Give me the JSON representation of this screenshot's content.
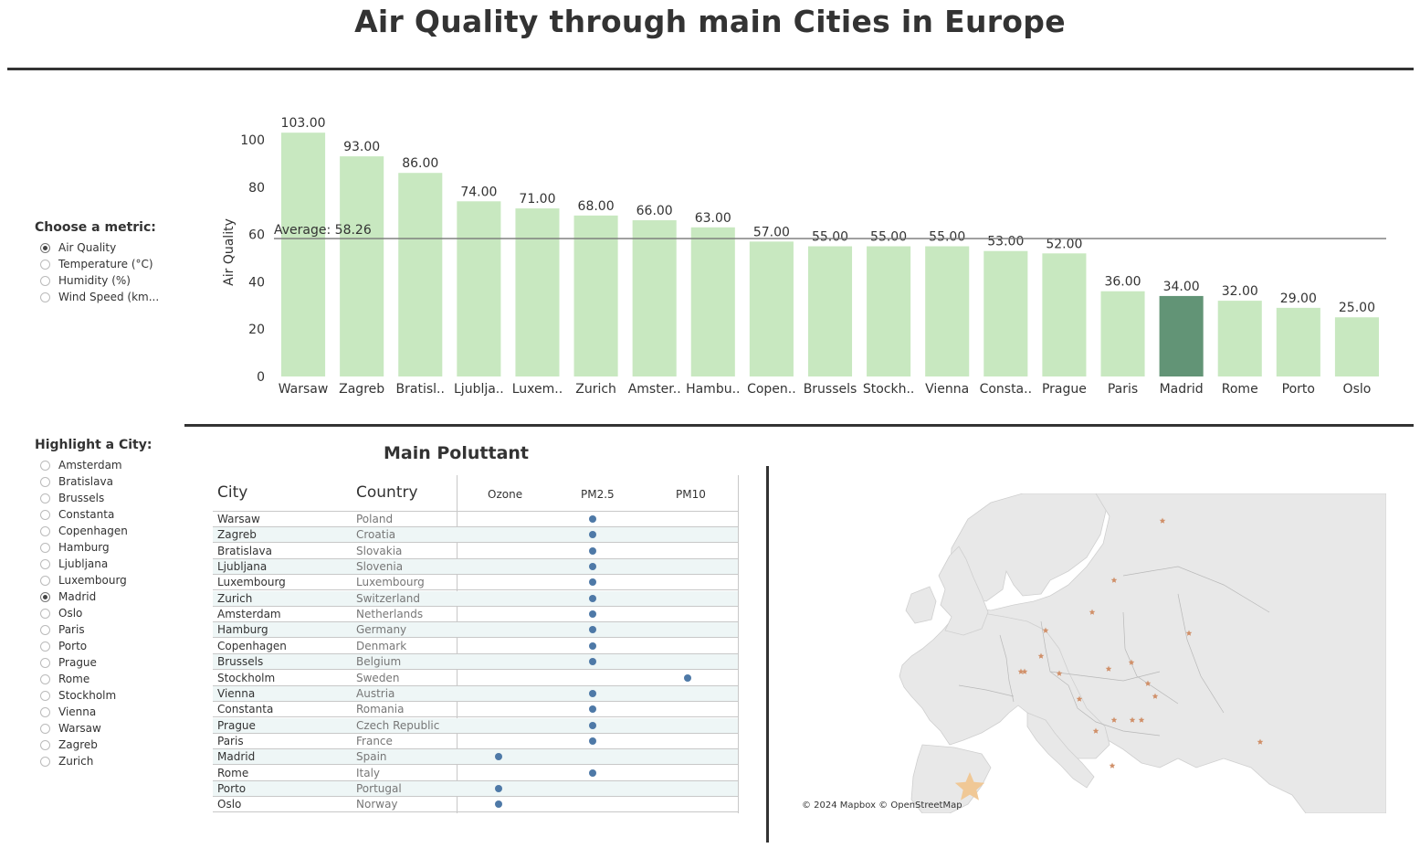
{
  "title": "Air Quality through main Cities in Europe",
  "metric_selector": {
    "heading": "Choose a metric:",
    "options": [
      {
        "label": "Air Quality",
        "selected": true
      },
      {
        "label": "Temperature (°C)",
        "selected": false
      },
      {
        "label": "Humidity (%)",
        "selected": false
      },
      {
        "label": "Wind Speed (km...",
        "selected": false
      }
    ]
  },
  "city_selector": {
    "heading": "Highlight a City:",
    "options": [
      {
        "label": "Amsterdam",
        "selected": false
      },
      {
        "label": "Bratislava",
        "selected": false
      },
      {
        "label": "Brussels",
        "selected": false
      },
      {
        "label": "Constanta",
        "selected": false
      },
      {
        "label": "Copenhagen",
        "selected": false
      },
      {
        "label": "Hamburg",
        "selected": false
      },
      {
        "label": "Ljubljana",
        "selected": false
      },
      {
        "label": "Luxembourg",
        "selected": false
      },
      {
        "label": "Madrid",
        "selected": true
      },
      {
        "label": "Oslo",
        "selected": false
      },
      {
        "label": "Paris",
        "selected": false
      },
      {
        "label": "Porto",
        "selected": false
      },
      {
        "label": "Prague",
        "selected": false
      },
      {
        "label": "Rome",
        "selected": false
      },
      {
        "label": "Stockholm",
        "selected": false
      },
      {
        "label": "Vienna",
        "selected": false
      },
      {
        "label": "Warsaw",
        "selected": false
      },
      {
        "label": "Zagreb",
        "selected": false
      },
      {
        "label": "Zurich",
        "selected": false
      }
    ]
  },
  "chart_data": {
    "type": "bar",
    "ylabel": "Air Quality",
    "ylim": [
      0,
      105
    ],
    "yticks": [
      0,
      20,
      40,
      60,
      80,
      100
    ],
    "categories": [
      "Warsaw",
      "Zagreb",
      "Bratisl..",
      "Ljublja..",
      "Luxem..",
      "Zurich",
      "Amster..",
      "Hambu..",
      "Copen..",
      "Brussels",
      "Stockh..",
      "Vienna",
      "Consta..",
      "Prague",
      "Paris",
      "Madrid",
      "Rome",
      "Porto",
      "Oslo"
    ],
    "values": [
      103,
      93,
      86,
      74,
      71,
      68,
      66,
      63,
      57,
      55,
      55,
      55,
      53,
      52,
      36,
      34,
      32,
      29,
      25
    ],
    "value_labels": [
      "103.00",
      "93.00",
      "86.00",
      "74.00",
      "71.00",
      "68.00",
      "66.00",
      "63.00",
      "57.00",
      "55.00",
      "55.00",
      "55.00",
      "53.00",
      "52.00",
      "36.00",
      "34.00",
      "32.00",
      "29.00",
      "25.00"
    ],
    "highlighted": "Madrid",
    "average": 58.26,
    "average_label": "Average: 58.26",
    "bar_color": "#c8e8c0",
    "highlight_color": "#629476",
    "grid": false
  },
  "pollutant_table": {
    "title": "Main Poluttant",
    "headers": {
      "city": "City",
      "country": "Country",
      "ozone": "Ozone",
      "pm25": "PM2.5",
      "pm10": "PM10"
    },
    "rows": [
      {
        "city": "Warsaw",
        "country": "Poland",
        "pollutant": "PM2.5"
      },
      {
        "city": "Zagreb",
        "country": "Croatia",
        "pollutant": "PM2.5"
      },
      {
        "city": "Bratislava",
        "country": "Slovakia",
        "pollutant": "PM2.5"
      },
      {
        "city": "Ljubljana",
        "country": "Slovenia",
        "pollutant": "PM2.5"
      },
      {
        "city": "Luxembourg",
        "country": "Luxembourg",
        "pollutant": "PM2.5"
      },
      {
        "city": "Zurich",
        "country": "Switzerland",
        "pollutant": "PM2.5"
      },
      {
        "city": "Amsterdam",
        "country": "Netherlands",
        "pollutant": "PM2.5"
      },
      {
        "city": "Hamburg",
        "country": "Germany",
        "pollutant": "PM2.5"
      },
      {
        "city": "Copenhagen",
        "country": "Denmark",
        "pollutant": "PM2.5"
      },
      {
        "city": "Brussels",
        "country": "Belgium",
        "pollutant": "PM2.5"
      },
      {
        "city": "Stockholm",
        "country": "Sweden",
        "pollutant": "PM10"
      },
      {
        "city": "Vienna",
        "country": "Austria",
        "pollutant": "PM2.5"
      },
      {
        "city": "Constanta",
        "country": "Romania",
        "pollutant": "PM2.5"
      },
      {
        "city": "Prague",
        "country": "Czech Republic",
        "pollutant": "PM2.5"
      },
      {
        "city": "Paris",
        "country": "France",
        "pollutant": "PM2.5"
      },
      {
        "city": "Madrid",
        "country": "Spain",
        "pollutant": "Ozone"
      },
      {
        "city": "Rome",
        "country": "Italy",
        "pollutant": "PM2.5"
      },
      {
        "city": "Porto",
        "country": "Portugal",
        "pollutant": "Ozone"
      },
      {
        "city": "Oslo",
        "country": "Norway",
        "pollutant": "Ozone"
      }
    ],
    "dot_color": "#4e79a7"
  },
  "map": {
    "credit": "© 2024 Mapbox © OpenStreetMap",
    "land_color": "#e8e8e8",
    "marker_color": "#d08f68",
    "highlight_marker_color": "#f0c896",
    "highlighted_city": "Madrid"
  }
}
